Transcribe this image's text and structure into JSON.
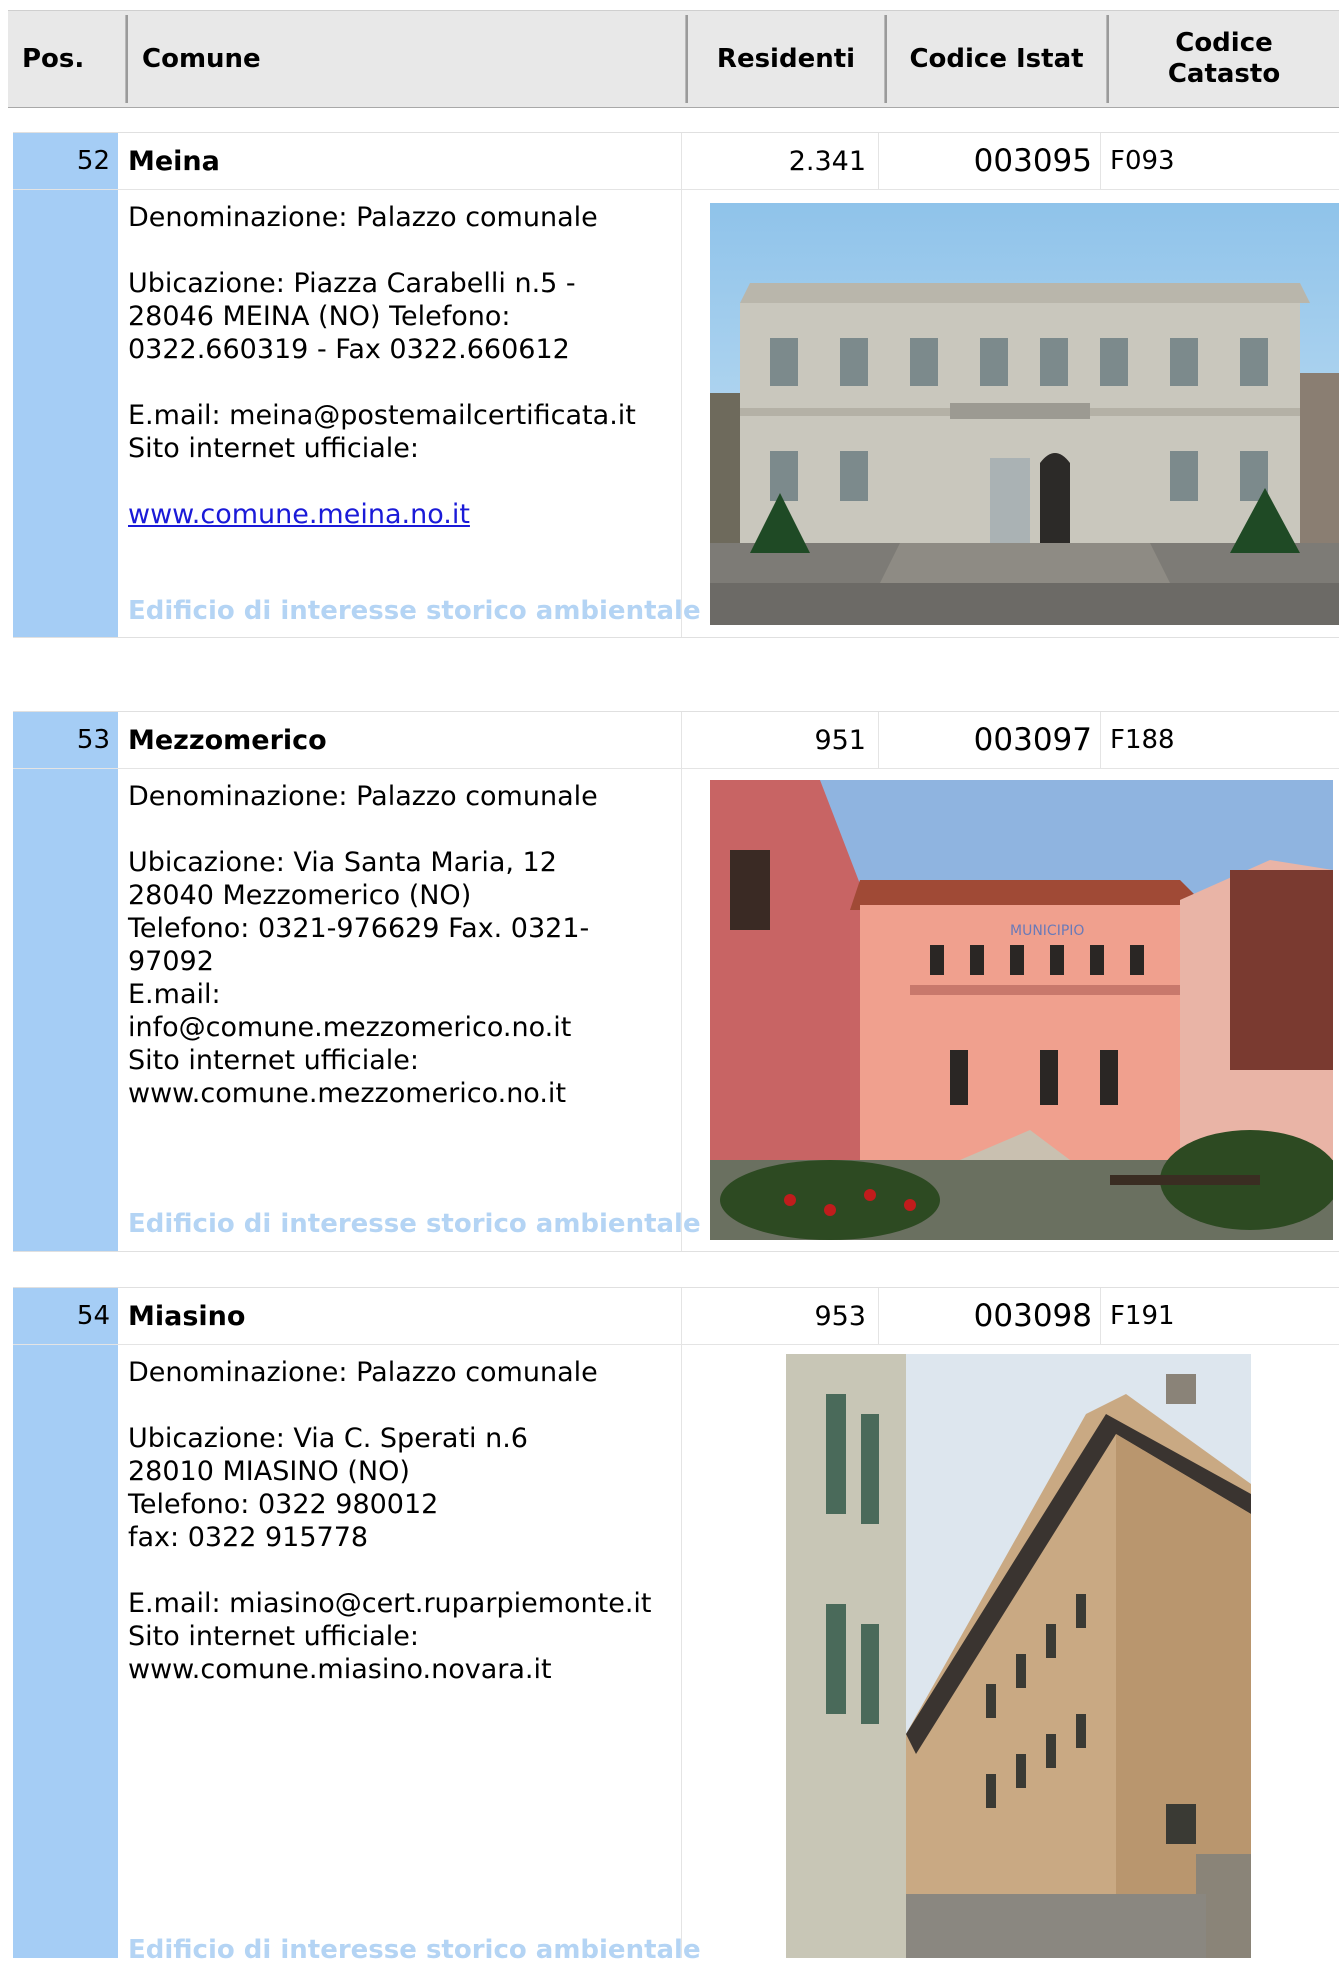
{
  "header": {
    "pos": "Pos.",
    "comune": "Comune",
    "residenti": "Residenti",
    "codice_istat": "Codice Istat",
    "codice_catasto_line1": "Codice",
    "codice_catasto_line2": "Catasto"
  },
  "note_label": "Edificio di interesse storico ambientale",
  "entries": [
    {
      "pos": "52",
      "name": "Meina",
      "residenti": "2.341",
      "istat": "003095",
      "catasto": "F093",
      "denominazione": "Denominazione: Palazzo comunale",
      "ubicazione_1": "Ubicazione: Piazza Carabelli n.5 -",
      "ubicazione_2": "28046 MEINA (NO) Telefono:",
      "ubicazione_3": "0322.660319 - Fax 0322.660612",
      "email": "E.mail: meina@postemailcertificata.it",
      "sito_label": "Sito internet ufficiale:",
      "sito_link": "www.comune.meina.no.it"
    },
    {
      "pos": "53",
      "name": "Mezzomerico",
      "residenti": "951",
      "istat": "003097",
      "catasto": "F188",
      "denominazione": "Denominazione: Palazzo comunale",
      "ubicazione_1": "Ubicazione: Via Santa Maria, 12",
      "ubicazione_2": "28040 Mezzomerico (NO)",
      "ubicazione_3": "Telefono: 0321-976629 Fax. 0321-",
      "ubicazione_4": "97092",
      "email_label": "E.mail:",
      "email": "info@comune.mezzomerico.no.it",
      "sito_label": "Sito internet ufficiale:",
      "sito": "www.comune.mezzomerico.no.it",
      "sign_text": "MUNICIPIO"
    },
    {
      "pos": "54",
      "name": "Miasino",
      "residenti": "953",
      "istat": "003098",
      "catasto": "F191",
      "denominazione": "Denominazione: Palazzo comunale",
      "ubicazione_1": "Ubicazione: Via C. Sperati n.6",
      "ubicazione_2": "28010 MIASINO (NO)",
      "ubicazione_3": "Telefono: 0322 980012",
      "ubicazione_4": "fax: 0322 915778",
      "email": "E.mail: miasino@cert.ruparpiemonte.it",
      "sito_label": "Sito internet ufficiale:",
      "sito": "www.comune.miasino.novara.it"
    }
  ]
}
